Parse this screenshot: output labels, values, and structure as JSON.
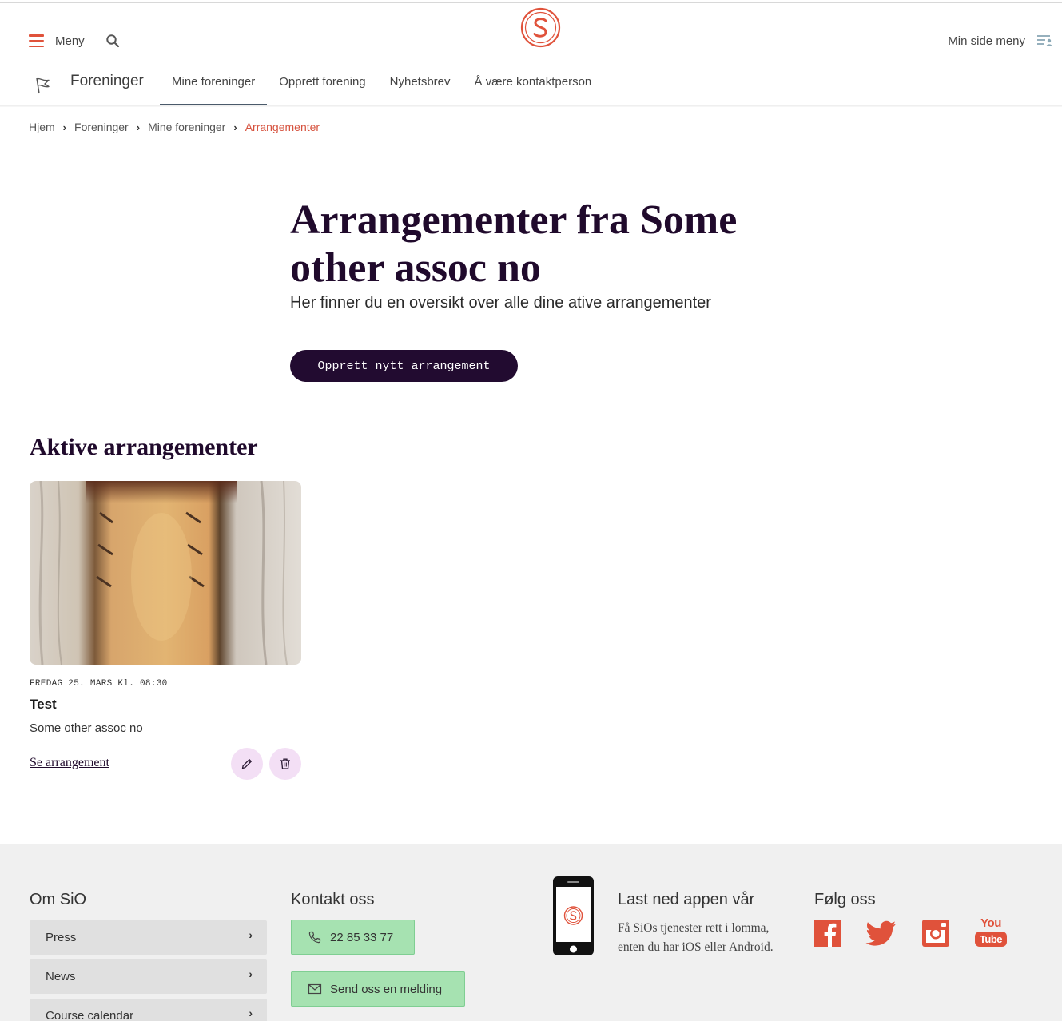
{
  "header": {
    "menu_label": "Meny",
    "my_page_label": "Min side meny"
  },
  "subnav": {
    "section_title": "Foreninger",
    "tabs": [
      {
        "label": "Mine foreninger",
        "active": true
      },
      {
        "label": "Opprett forening",
        "active": false
      },
      {
        "label": "Nyhetsbrev",
        "active": false
      },
      {
        "label": "Å være kontaktperson",
        "active": false
      }
    ]
  },
  "breadcrumb": {
    "items": [
      "Hjem",
      "Foreninger",
      "Mine foreninger"
    ],
    "current": "Arrangementer"
  },
  "hero": {
    "title": "Arrangementer fra Some other assoc no",
    "subtitle": "Her finner du en oversikt over alle dine ative arrangementer",
    "cta_label": "Opprett nytt arrangement"
  },
  "active_events": {
    "heading": "Aktive arrangementer",
    "cards": [
      {
        "date": "FREDAG 25. MARS Kl. 08:30",
        "title": "Test",
        "organizer": "Some other assoc no",
        "link_label": "Se arrangement",
        "edit_icon": "pencil-icon",
        "delete_icon": "trash-icon"
      }
    ]
  },
  "footer": {
    "about": {
      "heading": "Om SiO",
      "items": [
        "Press",
        "News",
        "Course calendar"
      ]
    },
    "contact": {
      "heading": "Kontakt oss",
      "phone": "22 85 33 77",
      "message_label": "Send oss en melding"
    },
    "app": {
      "heading": "Last ned appen vår",
      "text": "Få SiOs tjenester rett i lomma, enten du har iOS eller Android."
    },
    "follow": {
      "heading": "Følg oss",
      "icons": [
        "facebook-icon",
        "twitter-icon",
        "instagram-icon",
        "youtube-icon"
      ],
      "youtube_text_top": "You",
      "youtube_text_bottom": "Tube"
    }
  },
  "colors": {
    "brand_red": "#e0523b",
    "dark_purple": "#220b30",
    "footer_bg": "#f0f0f0",
    "contact_green": "#a6e2b1",
    "action_pink": "#f3dff5"
  }
}
